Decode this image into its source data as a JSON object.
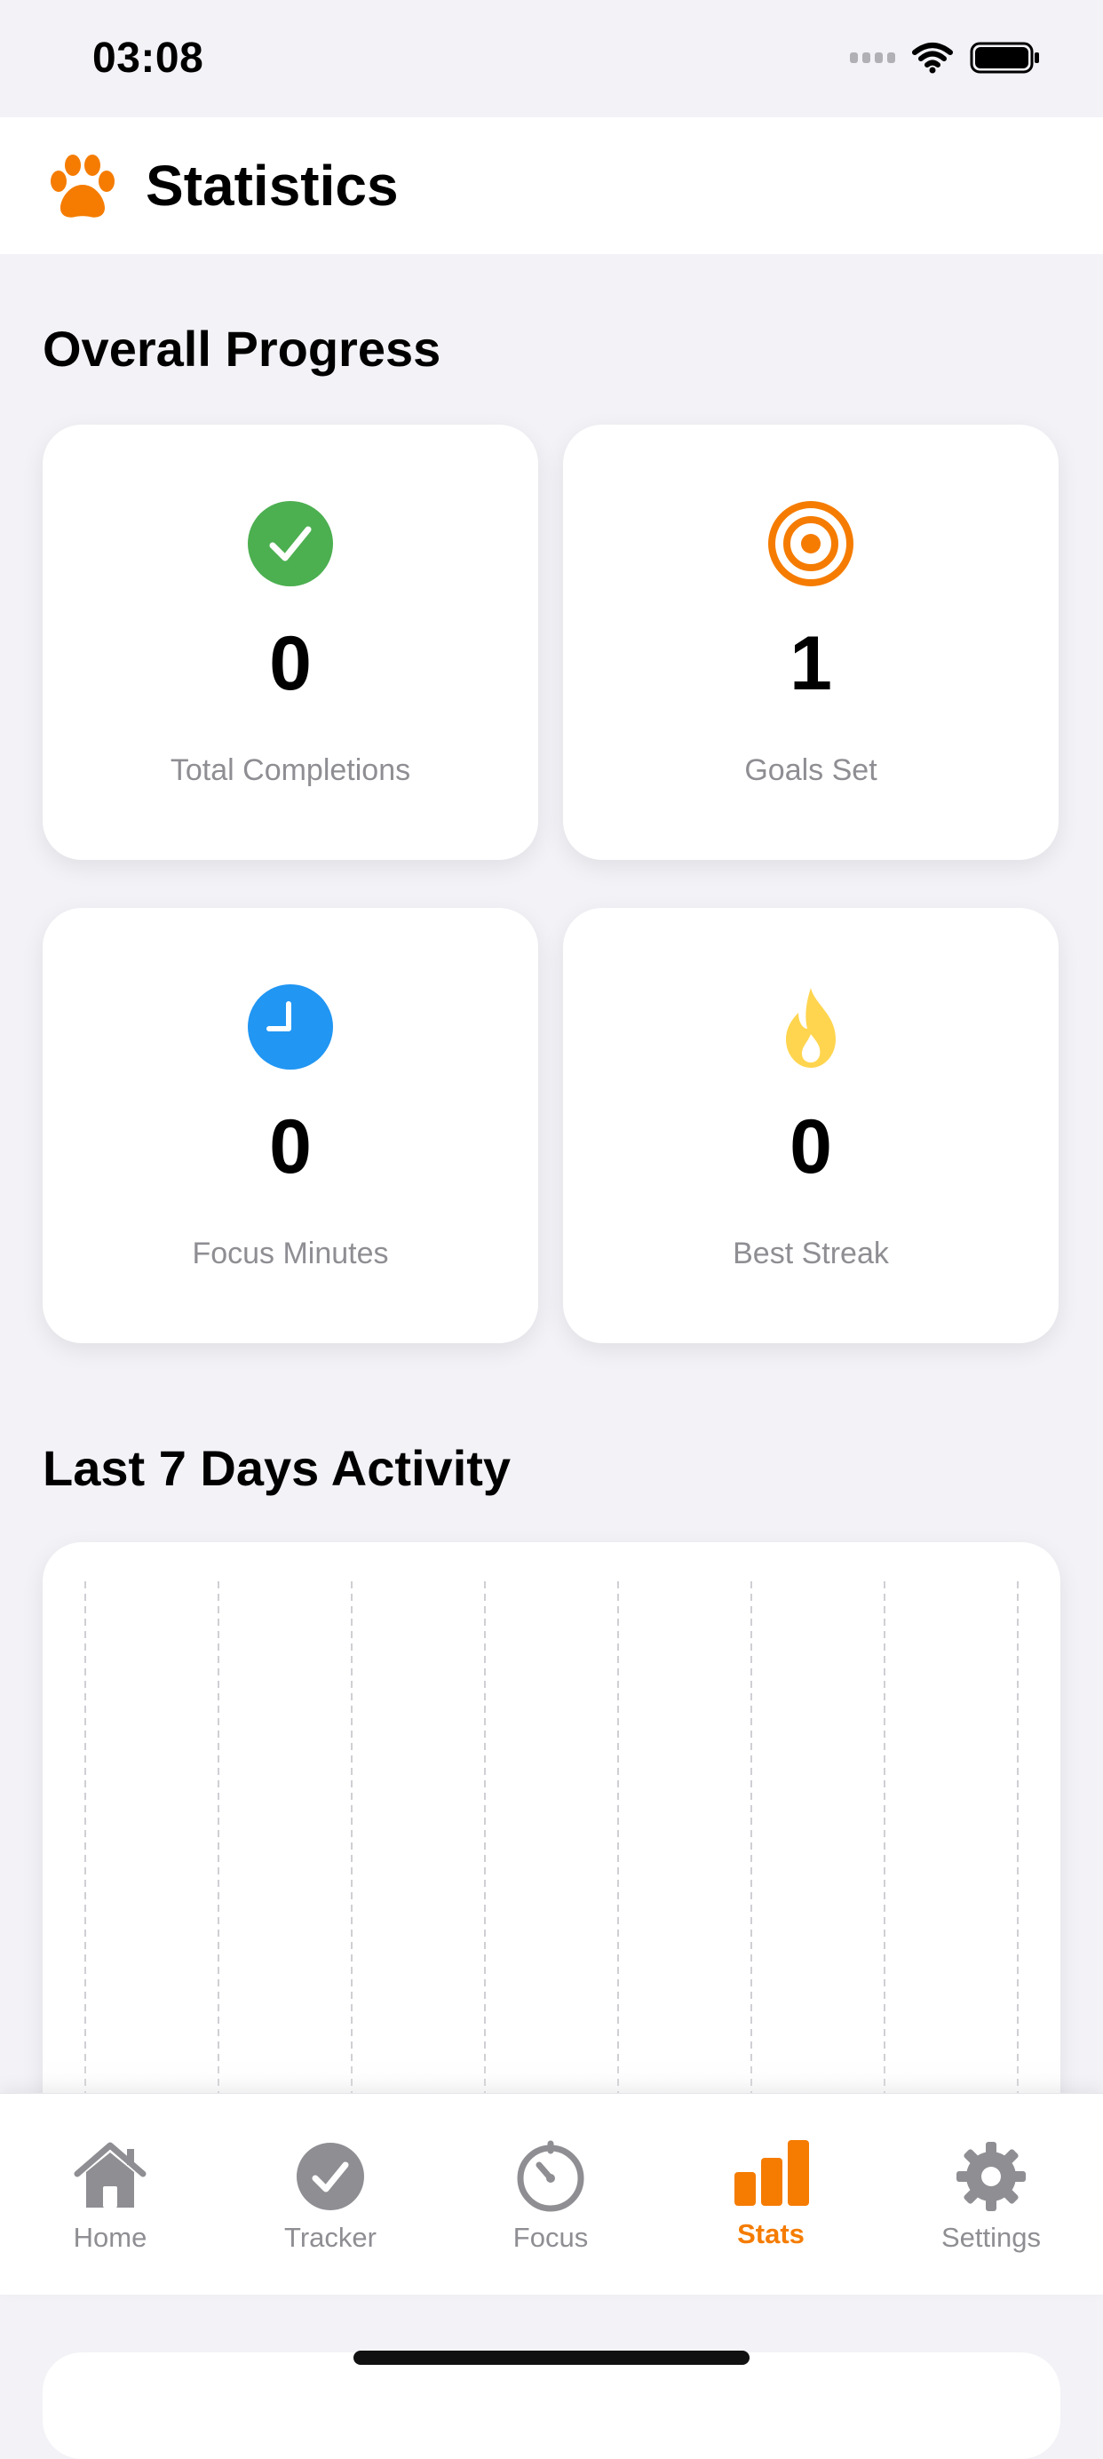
{
  "status_bar": {
    "time": "03:08"
  },
  "header": {
    "title": "Statistics",
    "icon": "paw-icon"
  },
  "overall": {
    "title": "Overall Progress",
    "cards": [
      {
        "icon": "checkmark-circle-icon",
        "value": "0",
        "label": "Total Completions",
        "color": "#4CAF50"
      },
      {
        "icon": "target-icon",
        "value": "1",
        "label": "Goals Set",
        "color": "#F57C00"
      },
      {
        "icon": "clock-icon",
        "value": "0",
        "label": "Focus Minutes",
        "color": "#2196F3"
      },
      {
        "icon": "flame-icon",
        "value": "0",
        "label": "Best Streak",
        "color": "#FFD54F"
      }
    ]
  },
  "activity": {
    "title": "Last 7 Days Activity"
  },
  "tab_bar": {
    "tabs": [
      {
        "label": "Home",
        "icon": "house-icon"
      },
      {
        "label": "Tracker",
        "icon": "checkmark-circle-icon"
      },
      {
        "label": "Focus",
        "icon": "timer-icon"
      },
      {
        "label": "Stats",
        "icon": "bar-chart-icon",
        "active": true
      },
      {
        "label": "Settings",
        "icon": "gear-icon"
      }
    ]
  },
  "colors": {
    "accent": "#F57C00",
    "background": "#F2F2F7",
    "inactive": "#8E8E93"
  }
}
